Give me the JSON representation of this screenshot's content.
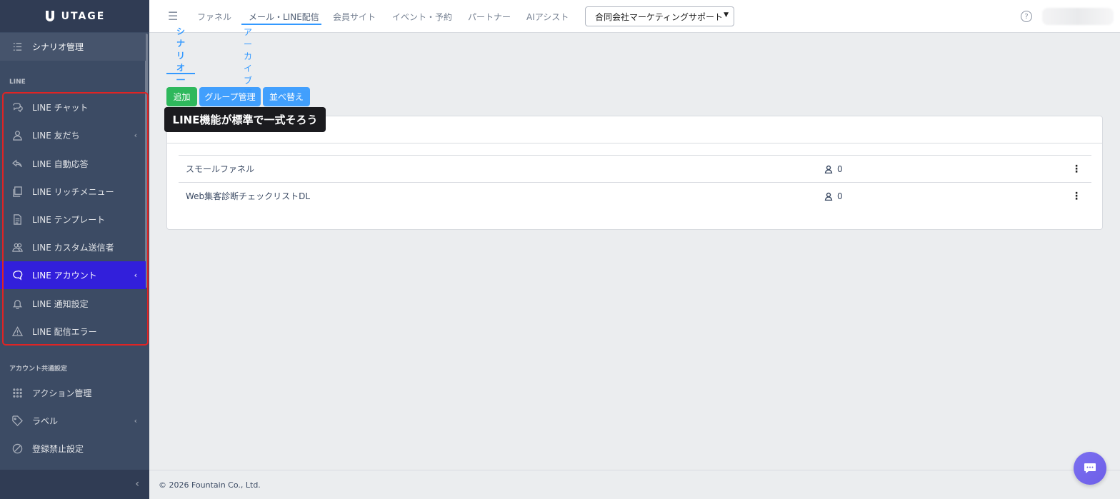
{
  "brand": {
    "name": "UTAGE"
  },
  "sidebar": {
    "top_item": {
      "label": "シナリオ管理",
      "icon": "list-icon"
    },
    "section_line": "LINE",
    "line_items": [
      {
        "label": "LINE チャット",
        "icon": "chat-icon",
        "chevron": ""
      },
      {
        "label": "LINE 友だち",
        "icon": "person-icon",
        "chevron": "‹"
      },
      {
        "label": "LINE 自動応答",
        "icon": "reply-icon",
        "chevron": ""
      },
      {
        "label": "LINE リッチメニュー",
        "icon": "layers-icon",
        "chevron": ""
      },
      {
        "label": "LINE テンプレート",
        "icon": "document-icon",
        "chevron": ""
      },
      {
        "label": "LINE カスタム送信者",
        "icon": "people-icon",
        "chevron": ""
      },
      {
        "label": "LINE アカウント",
        "icon": "bubble-icon",
        "chevron": "‹"
      },
      {
        "label": "LINE 通知設定",
        "icon": "bell-icon",
        "chevron": ""
      },
      {
        "label": "LINE 配信エラー",
        "icon": "warning-icon",
        "chevron": ""
      }
    ],
    "section_account": "アカウント共通設定",
    "account_items": [
      {
        "label": "アクション管理",
        "icon": "grid-icon",
        "chevron": ""
      },
      {
        "label": "ラベル",
        "icon": "tag-icon",
        "chevron": "‹"
      },
      {
        "label": "登録禁止設定",
        "icon": "ban-icon",
        "chevron": ""
      }
    ],
    "toggler": "‹"
  },
  "header": {
    "menu_icon": "☰",
    "nav": [
      "ファネル",
      "メール・LINE配信",
      "会員サイト",
      "イベント・予約",
      "パートナー",
      "AIアシスト"
    ],
    "active_nav": "メール・LINE配信",
    "company_select": "合同会社マーケティングサポート",
    "help": "?"
  },
  "tabs": [
    "シナリオ一覧",
    "アーカイブ済"
  ],
  "buttons": {
    "add": "追加",
    "group": "グループ管理",
    "sort": "並べ替え"
  },
  "tooltip": "LINE機能が標準で一式そろう",
  "scenarios": [
    {
      "name": "スモールファネル",
      "count": "0"
    },
    {
      "name": "Web集客診断チェックリストDL",
      "count": "0"
    }
  ],
  "footer": "© 2026 Fountain Co., Ltd.",
  "colors": {
    "sidebar": "#3c4b64",
    "active": "#321fdb",
    "accent": "#39f",
    "add": "#2eb85c",
    "highlight": "#e02424"
  }
}
